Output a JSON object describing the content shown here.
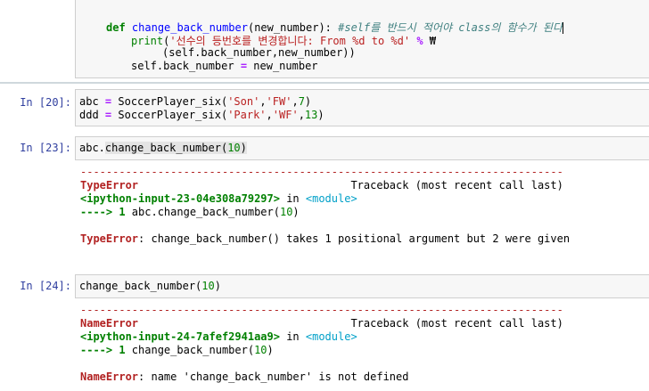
{
  "def_cell": {
    "line1": {
      "kw": "def",
      "fn": "change_back_number",
      "args": "(new_number): ",
      "comment": "#self를 반드시 적어야 class의 함수가 된다"
    },
    "line2": {
      "fn": "print",
      "paren": "(",
      "str": "'선수의 등번호를 변경합니다: From %d to %d'",
      "op": "%",
      "tail": " ₩"
    },
    "line3": {
      "text": "(self.back_number,new_number))"
    },
    "line4": {
      "lhs": "self.back_number ",
      "op": "=",
      "rhs": " new_number"
    }
  },
  "cell20": {
    "prompt": "In [20]:",
    "line1": {
      "a": "abc ",
      "eq": "=",
      "b": " SoccerPlayer_six(",
      "s1": "'Son'",
      "c1": ",",
      "s2": "'FW'",
      "c2": ",",
      "n": "7",
      "e": ")"
    },
    "line2": {
      "a": "ddd ",
      "eq": "=",
      "b": " SoccerPlayer_six(",
      "s1": "'Park'",
      "c1": ",",
      "s2": "'WF'",
      "c2": ",",
      "n": "13",
      "e": ")"
    }
  },
  "cell23": {
    "prompt": "In [23]:",
    "code_pre": "abc.",
    "code_hl": "change_back_number(",
    "code_num": "10",
    "code_end": ")",
    "dashes": "---------------------------------------------------------------------------",
    "error_name": "TypeError",
    "traceback_header": "                                 Traceback (most recent call last)",
    "ipy_input": "<ipython-input-23-04e308a79297>",
    "in_text": " in ",
    "module": "<module>",
    "arrow": "----> 1 ",
    "arrow_code": "abc.change_back_number(",
    "arrow_num": "10",
    "arrow_end": ")",
    "error_message": ": change_back_number() takes 1 positional argument but 2 were given"
  },
  "cell24": {
    "prompt": "In [24]:",
    "code_pre": "change_back_number(",
    "code_num": "10",
    "code_end": ")",
    "dashes": "---------------------------------------------------------------------------",
    "error_name": "NameError",
    "traceback_header": "                                 Traceback (most recent call last)",
    "ipy_input": "<ipython-input-24-7afef2941aa9>",
    "in_text": " in ",
    "module": "<module>",
    "arrow": "----> 1 ",
    "arrow_code": "change_back_number(",
    "arrow_num": "10",
    "arrow_end": ")",
    "error_message": ": name 'change_back_number' is not defined"
  }
}
